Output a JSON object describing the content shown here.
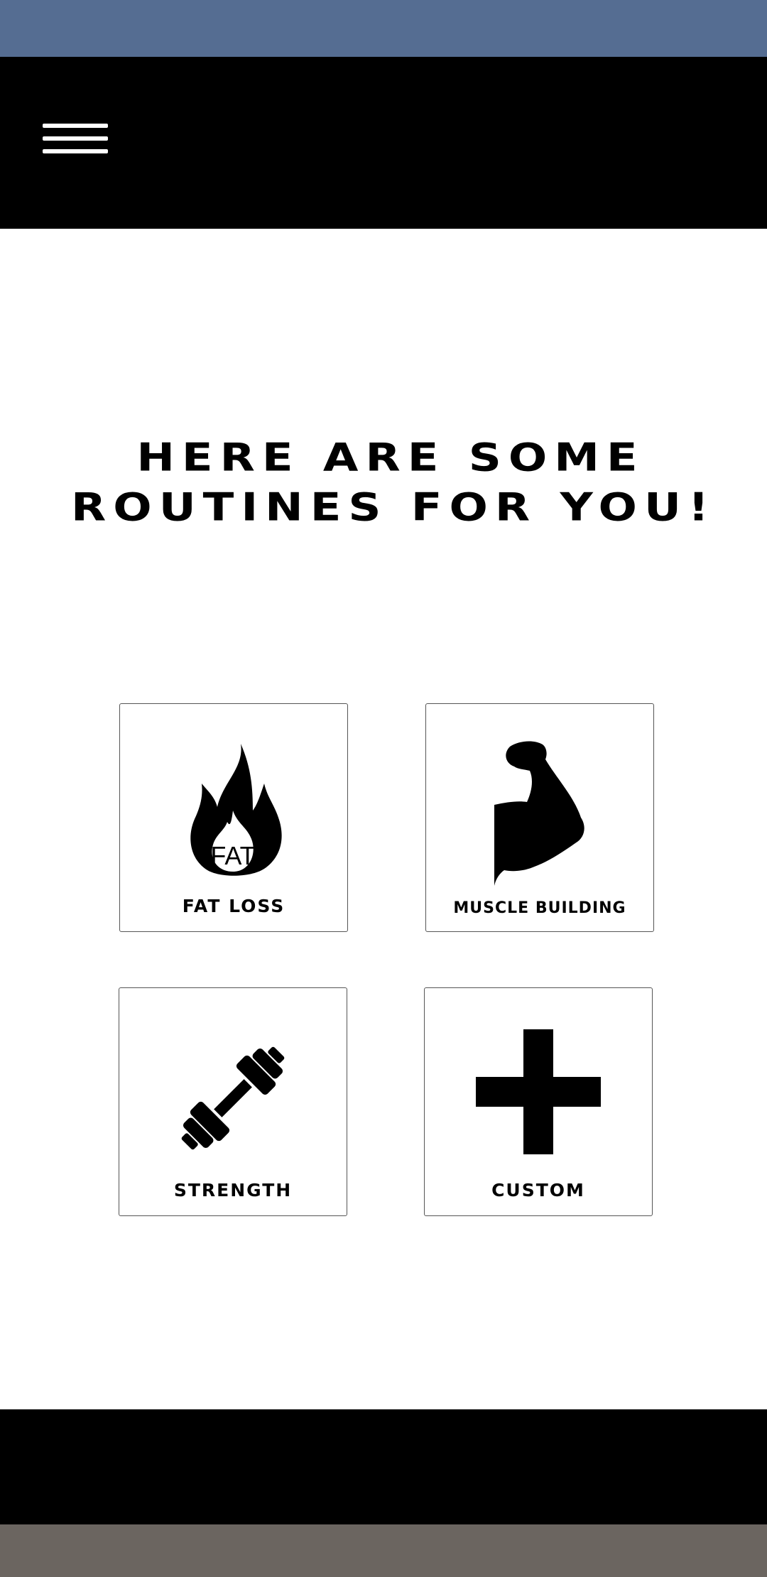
{
  "header": {
    "menu_icon": "hamburger-menu-icon"
  },
  "main": {
    "heading_line1": "HERE ARE SOME",
    "heading_line2": "ROUTINES FOR YOU!"
  },
  "routines": [
    {
      "label": "FAT LOSS",
      "icon": "flame-icon",
      "icon_text": "FAT"
    },
    {
      "label": "MUSCLE BUILDING",
      "icon": "flexed-arm-icon"
    },
    {
      "label": "STRENGTH",
      "icon": "dumbbell-icon"
    },
    {
      "label": "CUSTOM",
      "icon": "plus-icon"
    }
  ],
  "colors": {
    "status_bar": "#556d92",
    "app_bar": "#000000",
    "background": "#ffffff",
    "bottom_bar": "#000000",
    "nav_bar": "#6b6560"
  }
}
